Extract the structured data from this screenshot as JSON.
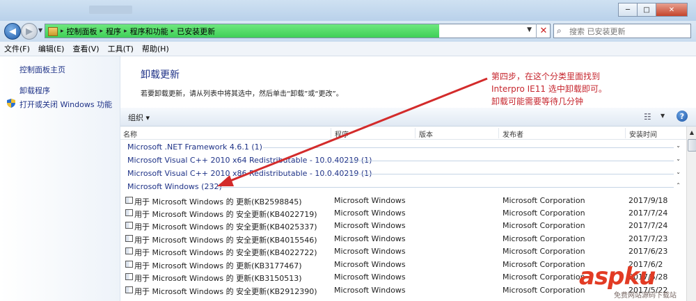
{
  "window": {
    "controls": [
      "─",
      "□",
      "✕"
    ]
  },
  "nav": {
    "breadcrumb": [
      "控制面板",
      "程序",
      "程序和功能",
      "已安装更新"
    ],
    "search_placeholder": "搜索 已安装更新"
  },
  "menu": [
    "文件(F)",
    "编辑(E)",
    "查看(V)",
    "工具(T)",
    "帮助(H)"
  ],
  "left_pane": {
    "home": "控制面板主页",
    "uninstall": "卸载程序",
    "features": "打开或关闭 Windows 功能"
  },
  "main": {
    "title": "卸载更新",
    "description": "若要卸载更新，请从列表中将其选中，然后单击“卸载”或“更改”。"
  },
  "annotation": {
    "line1": "第四步，在这个分类里面找到",
    "line2": "Interpro IE11  选中卸载即可。",
    "line3": "卸载可能需要等待几分钟",
    "color": "#c6262e"
  },
  "toolbar": {
    "organize": "组织 ▾"
  },
  "columns": [
    "名称",
    "程序",
    "版本",
    "发布者",
    "安装时间"
  ],
  "groups": [
    {
      "label": "Microsoft .NET Framework 4.6.1 (1)",
      "chevron": "⌄"
    },
    {
      "label": "Microsoft Visual C++ 2010  x64 Redistributable - 10.0.40219 (1)",
      "chevron": "⌄"
    },
    {
      "label": "Microsoft Visual C++ 2010  x86 Redistributable - 10.0.40219 (1)",
      "chevron": "⌄"
    },
    {
      "label": "Microsoft Windows (232)",
      "chevron": "⌃"
    }
  ],
  "rows": [
    {
      "name": "用于 Microsoft Windows 的 更新(KB2598845)",
      "program": "Microsoft Windows",
      "publisher": "Microsoft Corporation",
      "date": "2017/9/18"
    },
    {
      "name": "用于 Microsoft Windows 的 安全更新(KB4022719)",
      "program": "Microsoft Windows",
      "publisher": "Microsoft Corporation",
      "date": "2017/7/24"
    },
    {
      "name": "用于 Microsoft Windows 的 安全更新(KB4025337)",
      "program": "Microsoft Windows",
      "publisher": "Microsoft Corporation",
      "date": "2017/7/24"
    },
    {
      "name": "用于 Microsoft Windows 的 安全更新(KB4015546)",
      "program": "Microsoft Windows",
      "publisher": "Microsoft Corporation",
      "date": "2017/7/23"
    },
    {
      "name": "用于 Microsoft Windows 的 安全更新(KB4022722)",
      "program": "Microsoft Windows",
      "publisher": "Microsoft Corporation",
      "date": "2017/6/23"
    },
    {
      "name": "用于 Microsoft Windows 的 更新(KB3177467)",
      "program": "Microsoft Windows",
      "publisher": "Microsoft Corporation",
      "date": "2017/6/2"
    },
    {
      "name": "用于 Microsoft Windows 的 更新(KB3150513)",
      "program": "Microsoft Windows",
      "publisher": "Microsoft Corporation",
      "date": "2017/5/28"
    },
    {
      "name": "用于 Microsoft Windows 的 安全更新(KB2912390)",
      "program": "Microsoft Windows",
      "publisher": "Microsoft Corporation",
      "date": "2017/5/22"
    }
  ],
  "watermark": {
    "logo": "aspku",
    "sub": "免费网站源码下载站"
  }
}
